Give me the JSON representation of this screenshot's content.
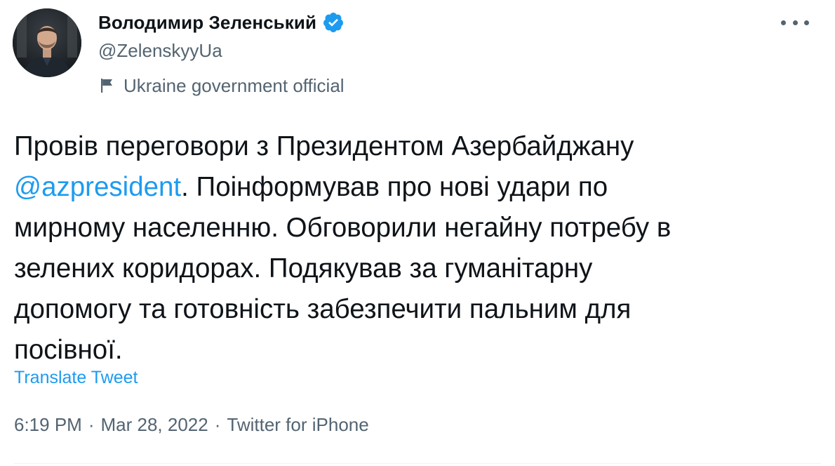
{
  "author": {
    "display_name": "Володимир Зеленський",
    "handle": "@ZelenskyyUa",
    "verified": true,
    "label": "Ukraine government official"
  },
  "tweet": {
    "text_before_mention": "Провів переговори з Президентом Азербайджану\n",
    "mention": "@azpresident",
    "text_after_mention": ". Поінформував про нові удари по\nмирному населенню. Обговорили негайну потребу в\nзелених коридорах. Подякував за гуманітарну\nдопомогу та готовність забезпечити пальним для\nпосівної.",
    "translate_label": "Translate Tweet",
    "time": "6:19 PM",
    "date": "Mar 28, 2022",
    "source": "Twitter for iPhone",
    "separator": "·"
  },
  "colors": {
    "accent": "#1d9bf0",
    "text_primary": "#0f1419",
    "text_secondary": "#536471"
  },
  "icons": {
    "verified": "verified-badge-icon",
    "label": "flag-icon",
    "more": "more-options-icon"
  }
}
